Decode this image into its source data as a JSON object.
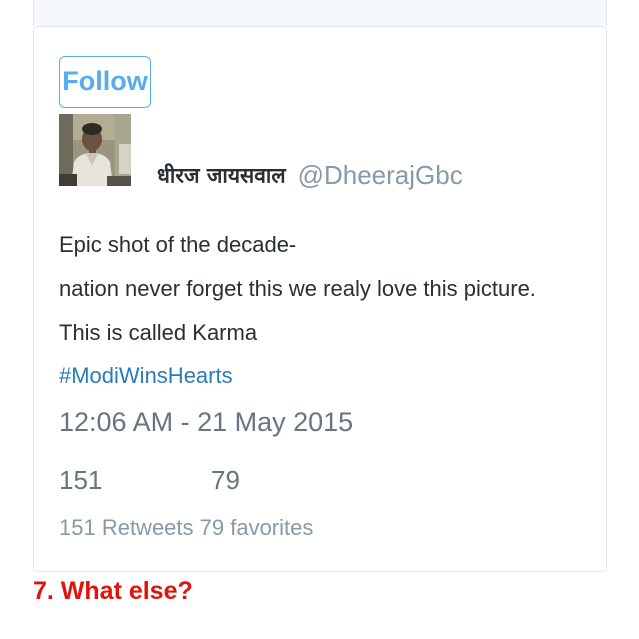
{
  "tweet": {
    "follow_label": "Follow",
    "author_name": "धीरज जायसवाल",
    "author_handle": "@DheerajGbc",
    "lines": [
      "Epic shot of the decade-",
      "nation never forget this we realy love this picture.",
      "This is called Karma"
    ],
    "hashtag": "#ModiWinsHearts",
    "timestamp": "12:06 AM - 21 May 2015",
    "retweet_count": "151",
    "favorite_count": "79",
    "stats_text": "151 Retweets 79 favorites"
  },
  "caption": "7. What else?",
  "colors": {
    "accent": "#55acee",
    "link": "#2b7bb9",
    "caption": "#e2120c",
    "text": "#292f33",
    "muted": "#66757f"
  }
}
